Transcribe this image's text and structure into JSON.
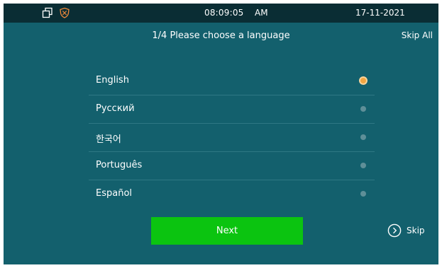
{
  "status_bar": {
    "time": "08:09:05",
    "ampm": "AM",
    "date": "17-11-2021",
    "icons": [
      "window-icon",
      "shield-icon"
    ]
  },
  "header": {
    "title": "1/4 Please choose a language",
    "skip_all_label": "Skip All"
  },
  "languages": [
    {
      "label": "English",
      "selected": true
    },
    {
      "label": "Русский",
      "selected": false
    },
    {
      "label": "한국어",
      "selected": false
    },
    {
      "label": "Português",
      "selected": false
    },
    {
      "label": "Español",
      "selected": false
    }
  ],
  "footer": {
    "next_label": "Next",
    "skip_label": "Skip"
  },
  "colors": {
    "background": "#13606d",
    "status_bar": "#0a2d34",
    "next_button": "#0bc410",
    "selected_radio": "#f2a541",
    "shield": "#f0893a"
  }
}
